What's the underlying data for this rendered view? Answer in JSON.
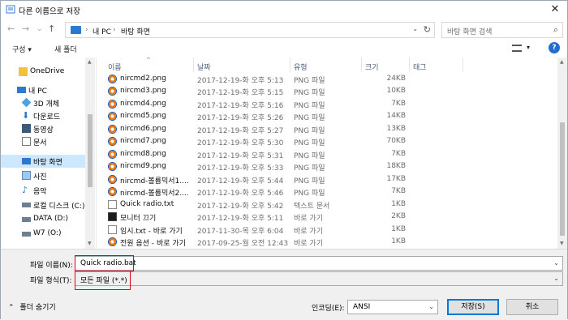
{
  "window": {
    "title": "다른 이름으로 저장",
    "close_label": "✕"
  },
  "nav": {
    "back": "←",
    "forward": "→",
    "up_dropdown": "⌄",
    "up": "↑",
    "breadcrumb": [
      "내 PC",
      "바탕 화면"
    ],
    "refresh": "↻",
    "search_placeholder": "바탕 화면 검색",
    "search_icon": "search-icon"
  },
  "toolbar": {
    "organize": "구성 ▾",
    "new_folder": "새 폴더",
    "view_dropdown": "▾",
    "help": "?"
  },
  "sidebar": {
    "items": [
      {
        "label": "OneDrive",
        "icon": "cloud-folder-icon"
      },
      {
        "label": "내 PC",
        "icon": "computer-icon"
      },
      {
        "label": "3D 개체",
        "icon": "3d-objects-icon"
      },
      {
        "label": "다운로드",
        "icon": "download-icon"
      },
      {
        "label": "동영상",
        "icon": "video-icon"
      },
      {
        "label": "문서",
        "icon": "document-icon"
      },
      {
        "label": "바탕 화면",
        "icon": "desktop-icon",
        "selected": true
      },
      {
        "label": "사진",
        "icon": "picture-icon"
      },
      {
        "label": "음악",
        "icon": "music-icon"
      },
      {
        "label": "로컬 디스크 (C:)",
        "icon": "drive-icon"
      },
      {
        "label": "DATA (D:)",
        "icon": "drive-icon"
      },
      {
        "label": "W7 (O:)",
        "icon": "drive-icon"
      }
    ]
  },
  "columns": {
    "name": "이름",
    "date": "날짜",
    "type": "유형",
    "size": "크기",
    "tag": "태그"
  },
  "files": [
    {
      "name": "nircmd2.png",
      "date": "2017-12-19-화 오후 5:13",
      "type": "PNG 파일",
      "size": "24KB",
      "icon": "png-icon"
    },
    {
      "name": "nircmd3.png",
      "date": "2017-12-19-화 오후 5:15",
      "type": "PNG 파일",
      "size": "10KB",
      "icon": "png-icon"
    },
    {
      "name": "nircmd4.png",
      "date": "2017-12-19-화 오후 5:16",
      "type": "PNG 파일",
      "size": "7KB",
      "icon": "png-icon"
    },
    {
      "name": "nircmd5.png",
      "date": "2017-12-19-화 오후 5:26",
      "type": "PNG 파일",
      "size": "14KB",
      "icon": "png-icon"
    },
    {
      "name": "nircmd6.png",
      "date": "2017-12-19-화 오후 5:27",
      "type": "PNG 파일",
      "size": "13KB",
      "icon": "png-icon"
    },
    {
      "name": "nircmd7.png",
      "date": "2017-12-19-화 오후 5:30",
      "type": "PNG 파일",
      "size": "70KB",
      "icon": "png-icon"
    },
    {
      "name": "nircmd8.png",
      "date": "2017-12-19-화 오후 5:31",
      "type": "PNG 파일",
      "size": "7KB",
      "icon": "png-icon"
    },
    {
      "name": "nircmd9.png",
      "date": "2017-12-19-화 오후 5:33",
      "type": "PNG 파일",
      "size": "18KB",
      "icon": "png-icon"
    },
    {
      "name": "nircmd-볼륨믹서1....",
      "date": "2017-12-19-화 오후 5:44",
      "type": "PNG 파일",
      "size": "17KB",
      "icon": "png-icon"
    },
    {
      "name": "nircmd-볼륨믹서2....",
      "date": "2017-12-19-화 오후 5:46",
      "type": "PNG 파일",
      "size": "7KB",
      "icon": "png-icon"
    },
    {
      "name": "Quick radio.txt",
      "date": "2017-12-19-화 오후 5:42",
      "type": "텍스트 문서",
      "size": "1KB",
      "icon": "text-file-icon"
    },
    {
      "name": "모니터 끄기",
      "date": "2017-12-19-화 오후 5:11",
      "type": "바로 가기",
      "size": "2KB",
      "icon": "shortcut-icon"
    },
    {
      "name": "임시.txt - 바로 가기",
      "date": "2017-11-30-목 오후 6:04",
      "type": "바로 가기",
      "size": "1KB",
      "icon": "shortcut-icon"
    },
    {
      "name": "전원 옵션 - 바로 가기",
      "date": "2017-09-25-월 오전 12:43",
      "type": "바로 가기",
      "size": "1KB",
      "icon": "shortcut-icon"
    }
  ],
  "save": {
    "filename_label": "파일 이름(N):",
    "filename_value": "Quick radio.bat",
    "filetype_label": "파일 형식(T):",
    "filetype_value": "모든 파일 (*.*)",
    "hide_folders": "폴더 숨기기",
    "encoding_label": "인코딩(E):",
    "encoding_value": "ANSI",
    "save_button": "저장(S)",
    "cancel_button": "취소",
    "highlight_color": "#e0001b"
  }
}
